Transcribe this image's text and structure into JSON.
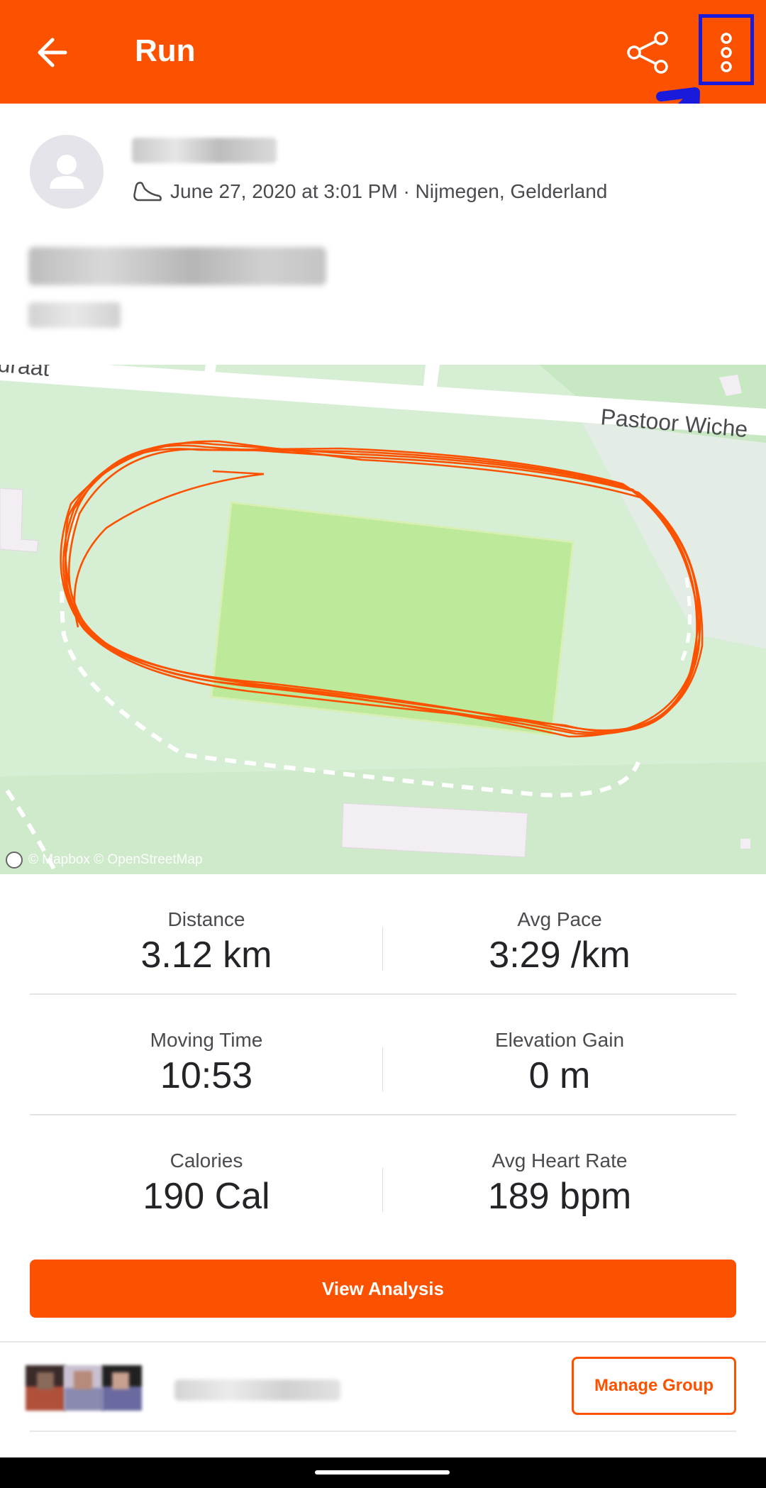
{
  "appbar": {
    "title": "Run",
    "back_icon": "arrow-left-icon",
    "share_icon": "share-icon",
    "more_icon": "more-vertical-icon",
    "color": "#fc5200"
  },
  "activity": {
    "date_location": "June 27, 2020 at 3:01 PM · Nijmegen, Gelderland",
    "sport_icon": "shoe-icon"
  },
  "map": {
    "street_label": "Pastoor Wiche",
    "street_label_left": "draat",
    "attribution": "© Mapbox © OpenStreetMap"
  },
  "stats": [
    {
      "label": "Distance",
      "value": "3.12 km"
    },
    {
      "label": "Avg Pace",
      "value": "3:29 /km"
    },
    {
      "label": "Moving Time",
      "value": "10:53"
    },
    {
      "label": "Elevation Gain",
      "value": "0 m"
    },
    {
      "label": "Calories",
      "value": "190 Cal"
    },
    {
      "label": "Avg Heart Rate",
      "value": "189 bpm"
    }
  ],
  "actions": {
    "view_analysis": "View Analysis",
    "manage_group": "Manage Group"
  }
}
